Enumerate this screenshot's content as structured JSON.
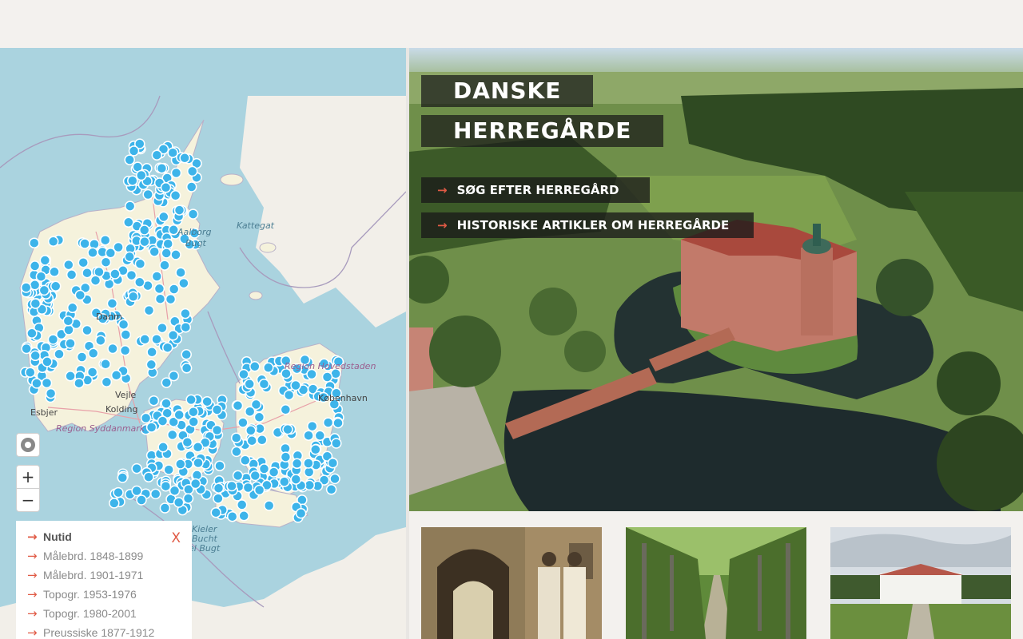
{
  "hero": {
    "title_line1": "DANSKE",
    "title_line2": "HERREGÅRDE",
    "links": [
      {
        "label": "SØG EFTER HERREGÅRD"
      },
      {
        "label": "HISTORISKE ARTIKLER OM HERREGÅRDE"
      }
    ]
  },
  "map": {
    "labels": {
      "kattegat": "Kattegat",
      "aalborg": "Aalborg",
      "bugt": "Bugt",
      "danmark": "Danm",
      "region_hovedstaden": "Region Hovedstaden",
      "kobenhavn": "København",
      "vejle": "Vejle",
      "kolding": "Kolding",
      "esbjerg": "Esbjer",
      "region_syddanmark": "Region Syddanmark",
      "kiel": "Kieler",
      "bucht": "Bucht",
      "bugt2": "el Bugt"
    },
    "controls": {
      "zoom_in": "+",
      "zoom_out": "−"
    },
    "layers": [
      {
        "label": "Nutid",
        "active": true
      },
      {
        "label": "Målebrd. 1848-1899"
      },
      {
        "label": "Målebrd. 1901-1971"
      },
      {
        "label": "Topogr. 1953-1976"
      },
      {
        "label": "Topogr. 1980-2001"
      },
      {
        "label": "Preussiske 1877-1912"
      }
    ],
    "close_label": "X",
    "marker_color": "#3db4ea"
  },
  "colors": {
    "accent": "#e05a45",
    "sea": "#aad3df",
    "land": "#f2efe9"
  }
}
